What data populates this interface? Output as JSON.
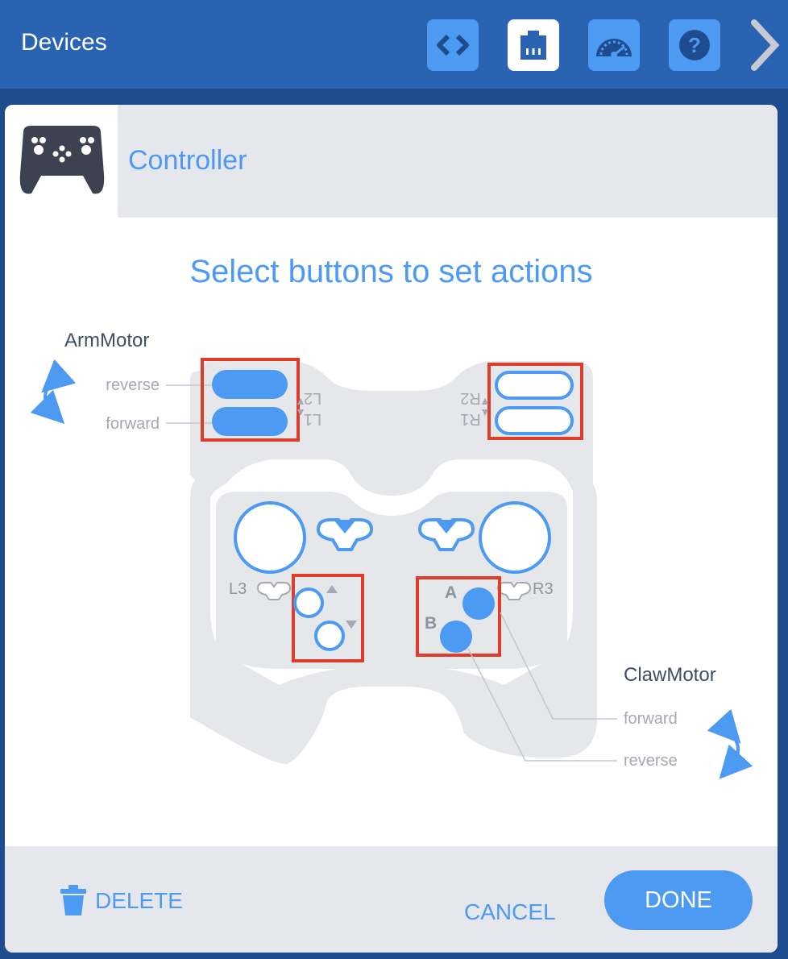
{
  "header": {
    "title": "Devices",
    "buttons": [
      "code-icon",
      "devices-icon",
      "dashboard-icon",
      "help-icon"
    ],
    "next_icon": "chevron-right-icon"
  },
  "dialog": {
    "device_name": "Controller",
    "device_icon": "gamepad-icon",
    "heading": "Select buttons to set actions",
    "arm_motor": {
      "name": "ArmMotor",
      "reverse_label": "reverse",
      "forward_label": "forward"
    },
    "claw_motor": {
      "name": "ClawMotor",
      "forward_label": "forward",
      "reverse_label": "reverse"
    },
    "button_labels": {
      "l2": "L2",
      "l1": "L1",
      "r2": "R2",
      "r1": "R1",
      "l3": "L3",
      "r3": "R3",
      "a": "A",
      "b": "B"
    },
    "footer": {
      "delete_label": "DELETE",
      "cancel_label": "CANCEL",
      "done_label": "DONE"
    }
  },
  "colors": {
    "accent": "#4d9af2",
    "header_bg": "#2a63b2",
    "highlight": "#e03c2a",
    "controller_body": "#e6e7eb"
  }
}
